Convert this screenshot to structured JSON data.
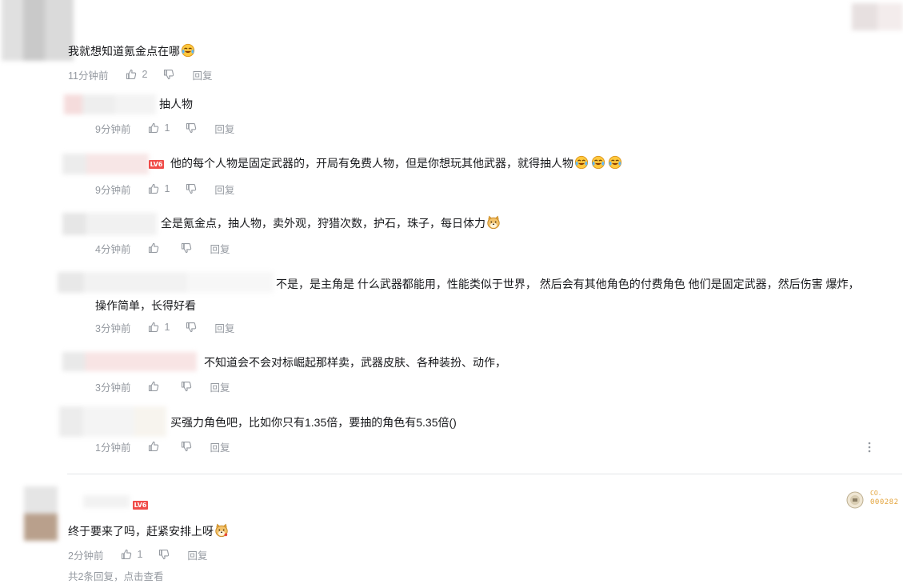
{
  "top_comment": {
    "text": "我就想知道氪金点在哪",
    "emoji": "laugh-cry-emoji",
    "time": "11分钟前",
    "likes": "2",
    "reply_label": "回复"
  },
  "replies": [
    {
      "text": "抽人物",
      "emojis": [],
      "time": "9分钟前",
      "likes": "1",
      "reply_label": "回复"
    },
    {
      "text": "他的每个人物是固定武器的，开局有免费人物，但是你想玩其他武器，就得抽人物",
      "emojis": [
        "laugh-cry-emoji",
        "laugh-cry-emoji",
        "laugh-cry-emoji"
      ],
      "level": "LV6",
      "time": "9分钟前",
      "likes": "1",
      "reply_label": "回复"
    },
    {
      "text": "全是氪金点，抽人物，卖外观，狩猎次数，护石，珠子，每日体力",
      "emojis": [
        "doge-emoji"
      ],
      "time": "4分钟前",
      "likes": "",
      "reply_label": "回复"
    },
    {
      "text": "不是，是主角是 什么武器都能用，性能类似于世界， 然后会有其他角色的付费角色 他们是固定武器，然后伤害 爆炸，",
      "text2": "操作简单，长得好看",
      "emojis": [],
      "time": "3分钟前",
      "likes": "1",
      "reply_label": "回复"
    },
    {
      "text": "不知道会不会对标崛起那样卖，武器皮肤、各种装扮、动作，",
      "emojis": [],
      "time": "3分钟前",
      "likes": "",
      "reply_label": "回复"
    },
    {
      "text": "买强力角色吧，比如你只有1.35倍，要抽的角色有5.35倍()",
      "emojis": [],
      "time": "1分钟前",
      "likes": "",
      "reply_label": "回复"
    }
  ],
  "more_icon": "more-vertical-icon",
  "second_comment": {
    "level": "LV6",
    "text": "终于要来了吗，赶紧安排上呀",
    "emoji": "doge-emoji",
    "time": "2分钟前",
    "likes": "1",
    "reply_label": "回复",
    "footer": "共2条回复，点击查看",
    "badge_line1": "CO.",
    "badge_line2": "000282"
  },
  "colors": {
    "text": "#18191c",
    "meta": "#9499a0",
    "level": "#f04c49",
    "divider": "#e3e5e7",
    "badge": "#e3a33a"
  }
}
